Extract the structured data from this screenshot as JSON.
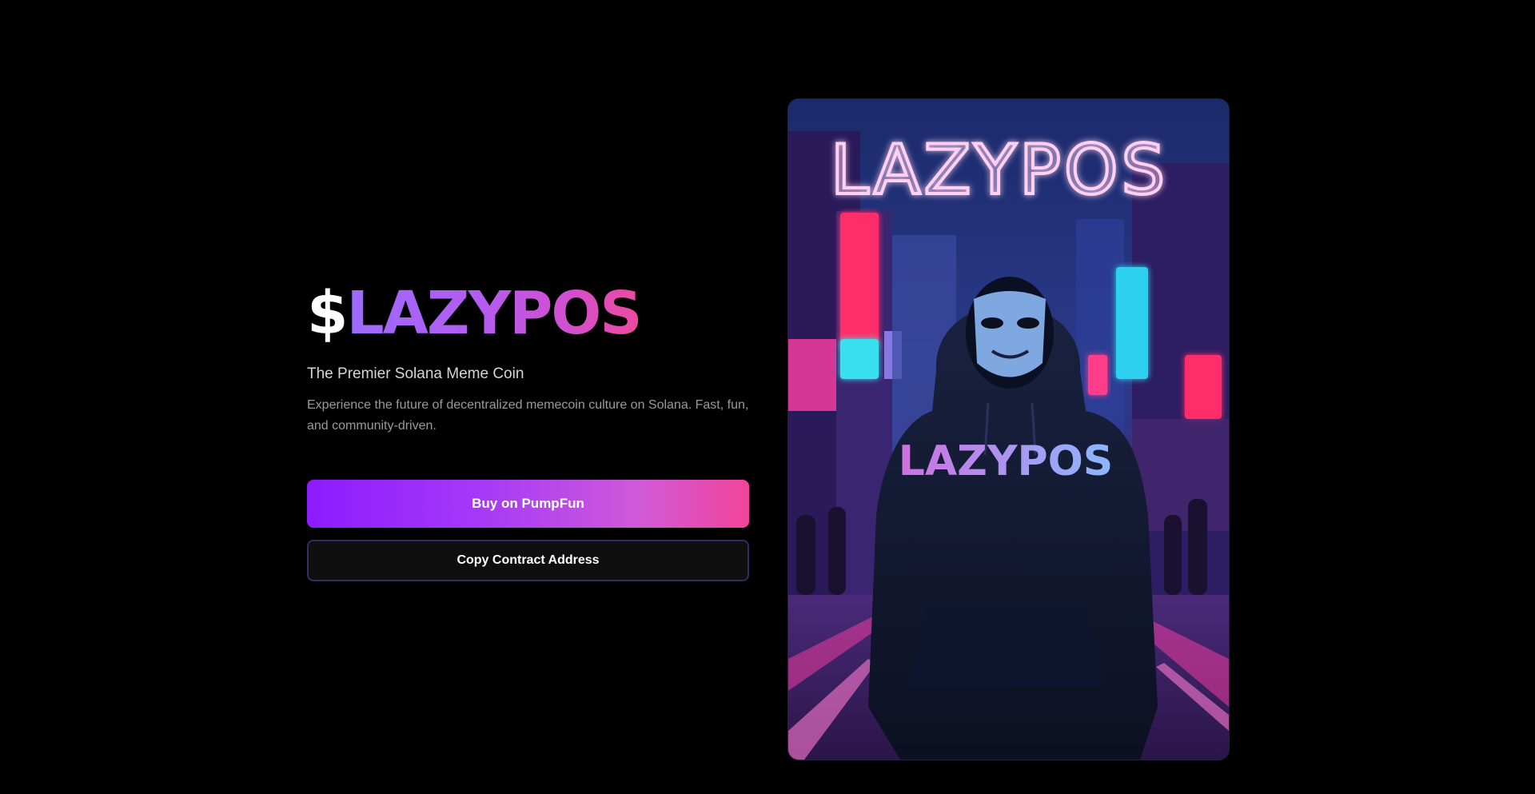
{
  "hero": {
    "brand_prefix": "$",
    "brand_name": "LAZYPOS",
    "tagline": "The Premier Solana Meme Coin",
    "description": "Experience the future of decentralized memecoin culture on Solana. Fast, fun, and community-driven."
  },
  "actions": {
    "buy_label": "Buy on PumpFun",
    "copy_label": "Copy Contract Address"
  },
  "image": {
    "neon_sign_text": "LAZYPOS",
    "hoodie_text": "LAZYPOS"
  },
  "colors": {
    "background": "#000000",
    "accent_purple": "#8d1bff",
    "accent_pink": "#f2449a"
  }
}
